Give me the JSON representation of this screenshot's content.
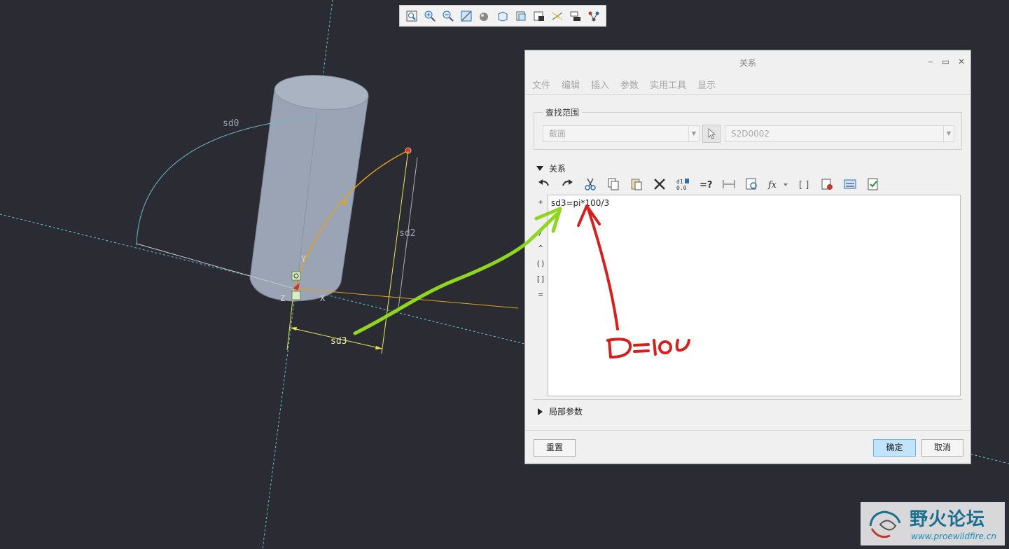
{
  "scene": {
    "dimensions": [
      "sd0",
      "sd2",
      "sd3"
    ],
    "axes": {
      "y": "Y",
      "z": "Z",
      "x": "X"
    }
  },
  "graphics_toolbar": {
    "icons": [
      "zoom-window-icon",
      "zoom-in-icon",
      "zoom-out-icon",
      "refit-icon",
      "display-style-icon",
      "saved-views-icon",
      "view-orient-icon",
      "layer-icon",
      "datum-display-icon",
      "annotation-display-icon",
      "spin-center-icon"
    ]
  },
  "dialog": {
    "title": "关系",
    "window_buttons": [
      "‒",
      "▭",
      "✕"
    ],
    "menu": [
      "文件",
      "编辑",
      "插入",
      "参数",
      "实用工具",
      "显示"
    ],
    "scope": {
      "label": "查找范围",
      "type_value": "截面",
      "feature_value": "S2D0002"
    },
    "relations_label": "关系",
    "toolbar_icons": [
      "undo-icon",
      "redo-icon",
      "cut-icon",
      "copy-icon",
      "paste-icon",
      "delete-icon",
      "sort-icon",
      "evaluate-icon",
      "show-dimension-icon",
      "insert-from-list-icon",
      "function-icon",
      "parentheses-icon",
      "verify-icon",
      "units-icon",
      "check-icon"
    ],
    "operators": [
      "+",
      "-",
      "/",
      "^",
      "()",
      "[]",
      "="
    ],
    "editor_text": "sd3=pi*100/3",
    "local_params_label": "局部参数",
    "buttons": {
      "reset": "重置",
      "ok": "确定",
      "cancel": "取消"
    }
  },
  "annotation": {
    "handwritten": "D=100",
    "arrow_colors": {
      "green": "#8fd61f",
      "red": "#d62020"
    }
  },
  "watermark": {
    "title": "野火论坛",
    "url": "www.proewildfire.cn"
  }
}
